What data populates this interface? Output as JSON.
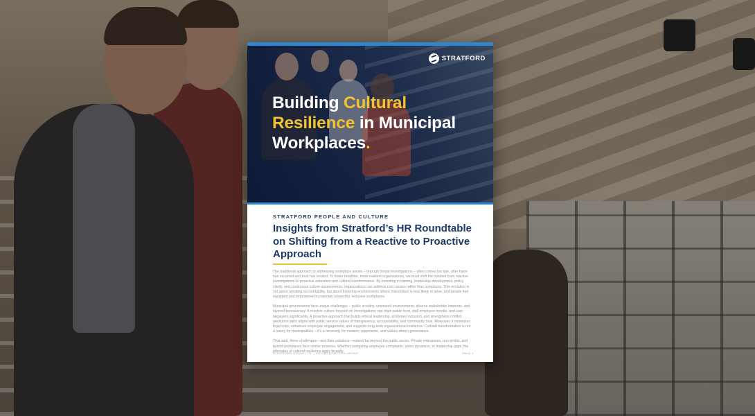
{
  "document": {
    "logo_text": "STRATFORD",
    "title_parts": {
      "line1_a": "Building ",
      "line1_b": "Cultural",
      "line2_a": "Resilience",
      "line2_b": " in Municipal",
      "line3_a": "Workplaces",
      "line3_b": "."
    },
    "kicker": "STRATFORD PEOPLE AND CULTURE",
    "subhead": "Insights from Stratford’s HR Roundtable on Shifting from a Reactive to Proactive Approach",
    "paragraphs": [
      "The traditional approach to addressing workplace issues – through formal investigations – often comes too late, after harm has occurred and trust has eroded. To foster healthier, more resilient organizations, we must shift the mindset from reactive investigations to proactive education and cultural transformation. By investing in training, leadership development, policy clarity, and continuous culture assessments, organizations can address root causes rather than symptoms. This evolution is not about avoiding accountability, but about fostering environments where misconduct is less likely to arise, and people feel equipped and empowered to maintain respectful, inclusive workplaces.",
      "Municipal governments face unique challenges – public scrutiny, unionized environments, diverse stakeholder interests, and layered bureaucracy. A reactive culture focused on investigations can drain public trust, stall employee morale, and cost taxpayers significantly. A proactive approach that builds ethical leadership, promotes inclusion, and strengthens conflict resolution skills aligns with public service values of transparency, accountability, and community trust. Moreover, it minimizes legal risks, enhances employee engagement, and supports long-term organizational resilience. Cultural transformation is not a luxury for municipalities – it’s a necessity for modern, responsive, and values-driven governance.",
      "That said, these challenges—and their solutions—extend far beyond the public sector. Private enterprises, non-profits, and hybrid workplaces face similar tensions. Whether navigating employee complaints, union dynamics, or leadership gaps, the principles of cultural resilience apply broadly."
    ],
    "footer_left": "STRATFORD GROUP LTD. | INFO@STRATFORD.GROUP",
    "footer_right": "PAGE 1"
  },
  "colors": {
    "accent_blue": "#2e86d0",
    "highlight_yellow": "#f2c230",
    "navy": "#1d3a66"
  }
}
